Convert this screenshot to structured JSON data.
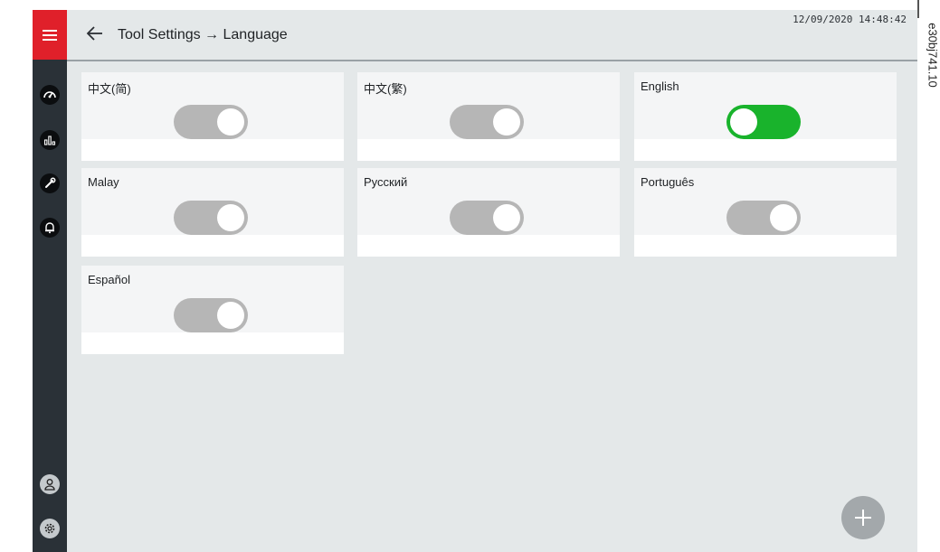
{
  "header": {
    "title": "Tool Settings → Language",
    "datetime": "12/09/2020 14:48:42"
  },
  "sidebar": {
    "items": [
      {
        "icon": "menu-icon"
      },
      {
        "icon": "gauge-icon"
      },
      {
        "icon": "chart-icon"
      },
      {
        "icon": "wrench-icon"
      },
      {
        "icon": "bell-icon"
      },
      {
        "icon": "user-icon"
      },
      {
        "icon": "gear-icon"
      }
    ]
  },
  "languages": [
    {
      "label": "中文(简)",
      "enabled": false
    },
    {
      "label": "中文(繁)",
      "enabled": false
    },
    {
      "label": "English",
      "enabled": true
    },
    {
      "label": "Malay",
      "enabled": false
    },
    {
      "label": "Русский",
      "enabled": false
    },
    {
      "label": "Português",
      "enabled": false
    },
    {
      "label": "Español",
      "enabled": false
    }
  ],
  "fab": {
    "icon": "plus-icon"
  },
  "figure_code": "e30bj741.10",
  "colors": {
    "menu_red": "#e0202a",
    "sidebar": "#2a3137",
    "toggle_on": "#19b32c",
    "toggle_off": "#b6b6b6"
  }
}
